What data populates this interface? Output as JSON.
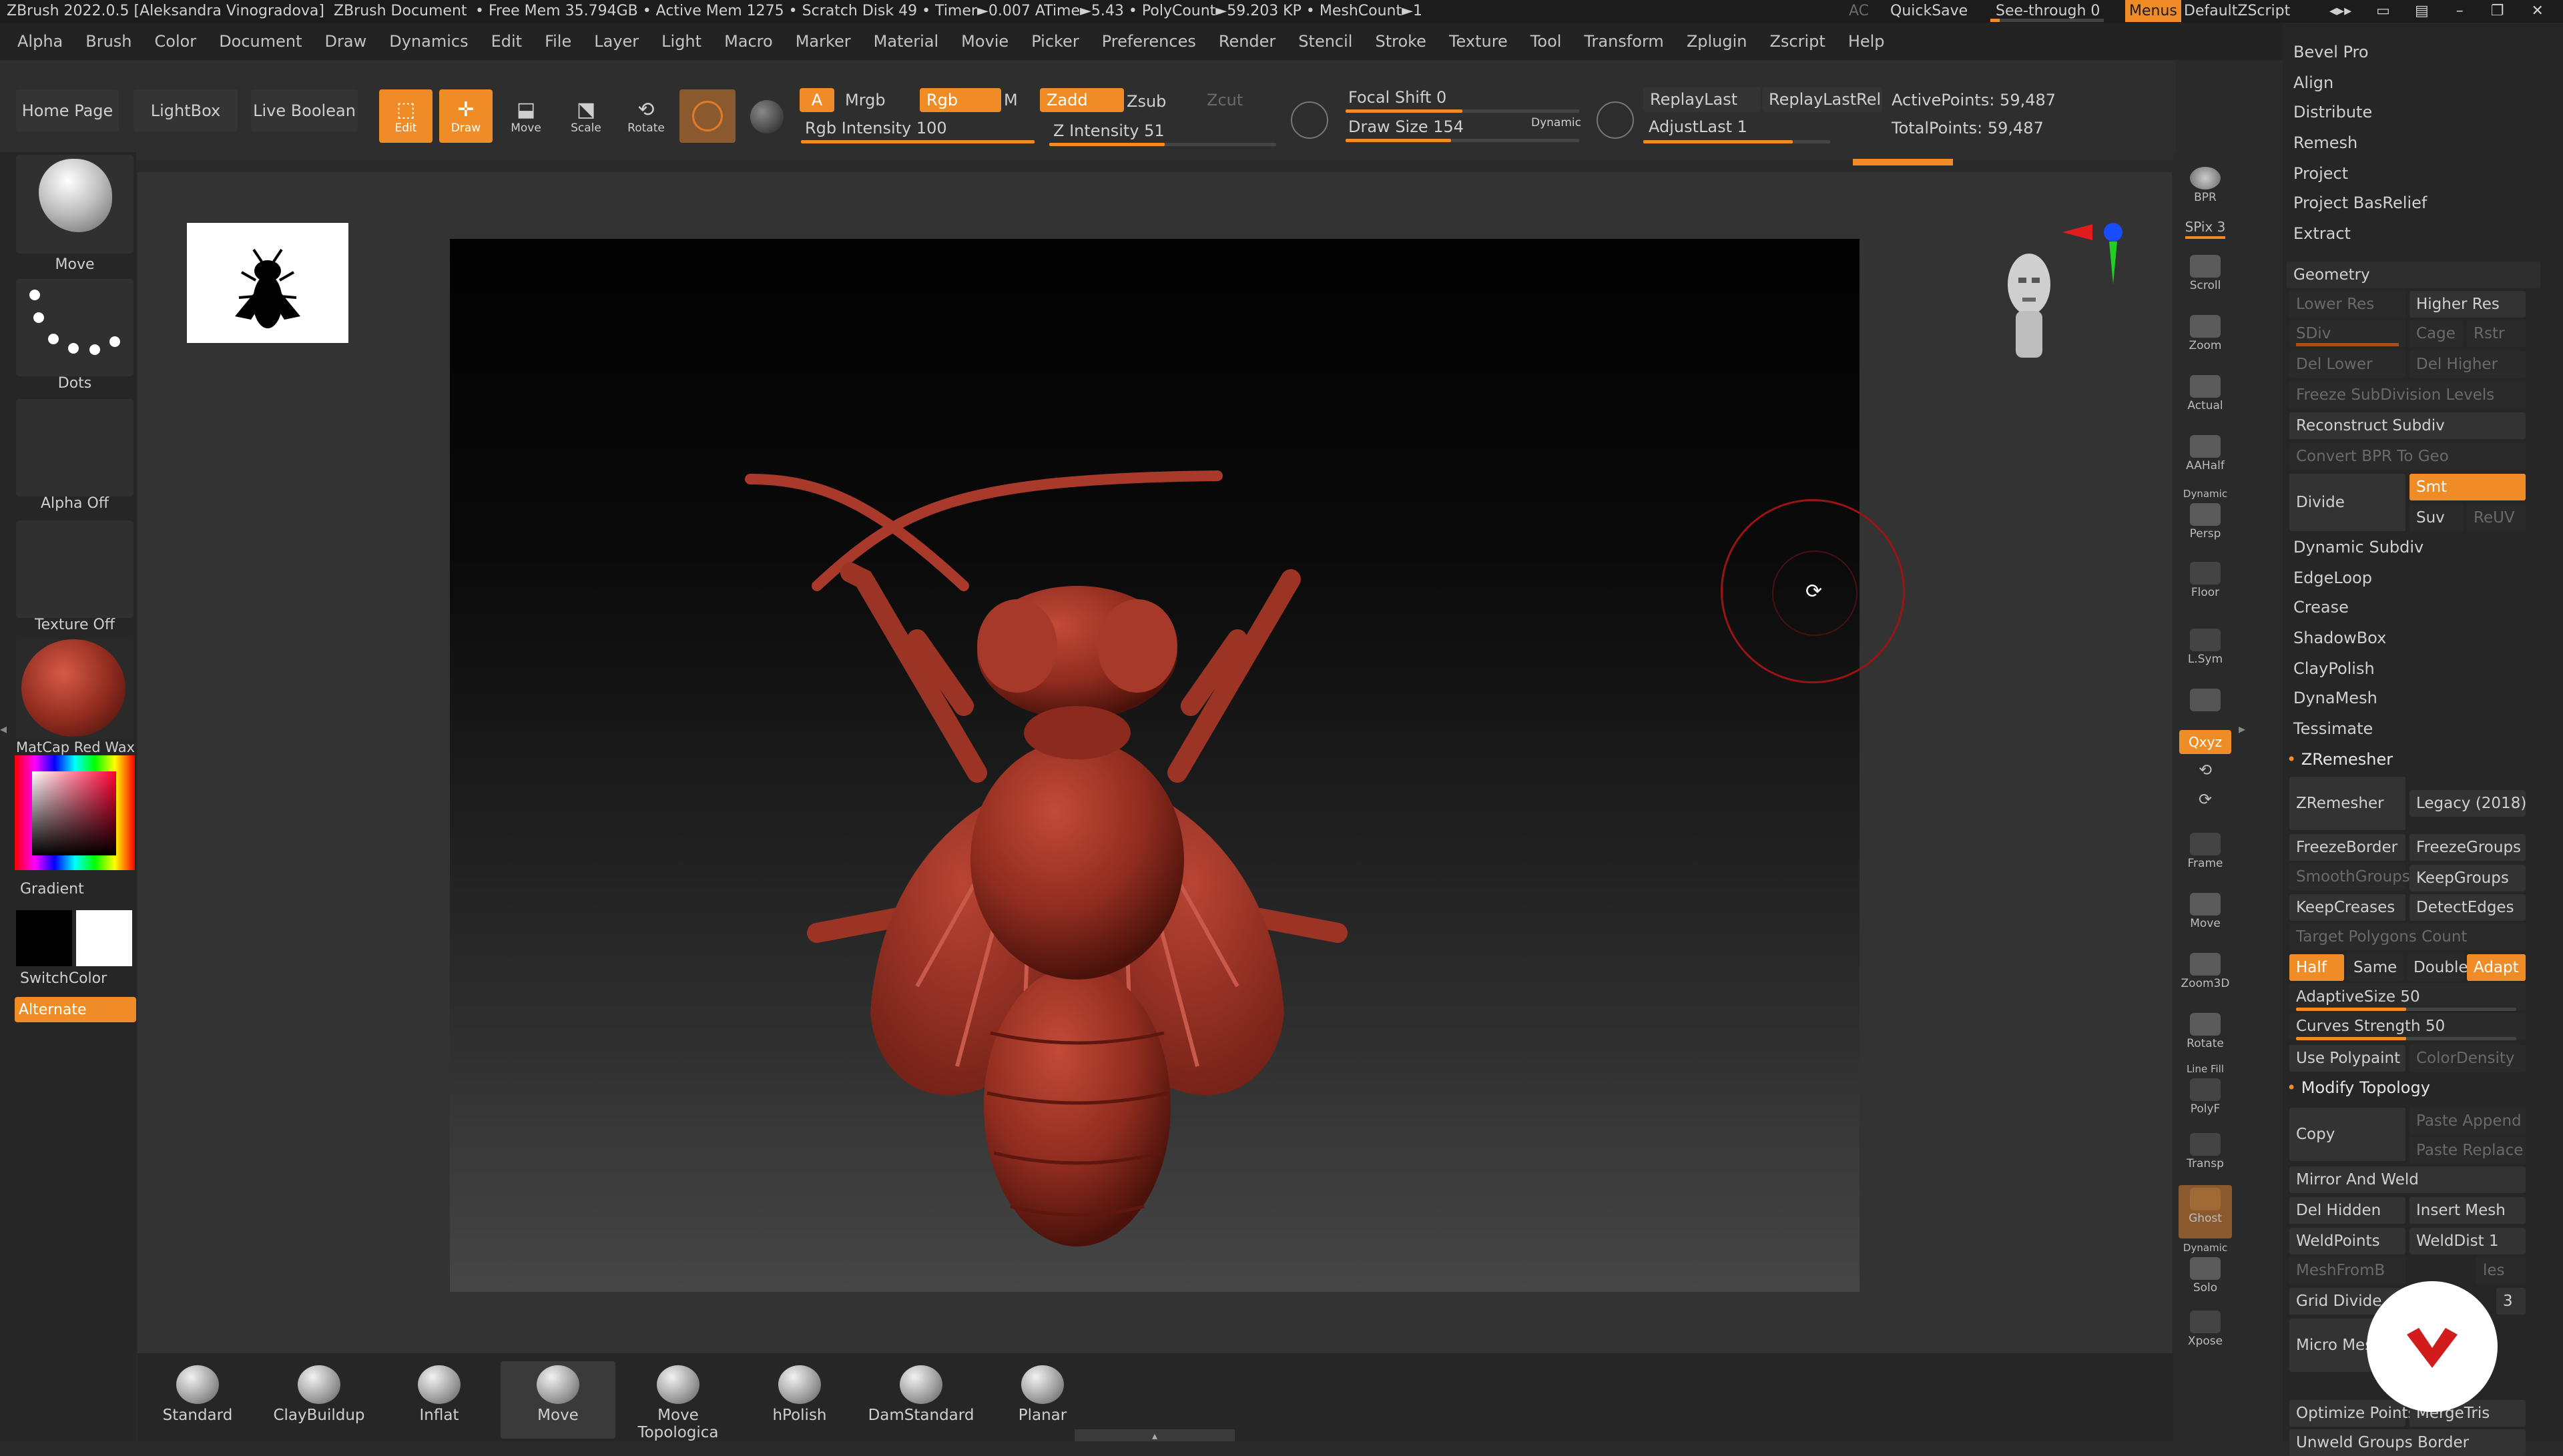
{
  "titlebar": {
    "app": "ZBrush 2022.0.5 [Aleksandra Vinogradova]",
    "doc": "ZBrush Document",
    "stats": "• Free Mem 35.794GB • Active Mem 1275 • Scratch Disk 49 • Timer►0.007 ATime►5.43 • PolyCount►59.203 KP • MeshCount►1",
    "ac": "AC",
    "quicksave": "QuickSave",
    "seethrough": "See-through 0",
    "menus": "Menus",
    "script": "DefaultZScript"
  },
  "menu": [
    "Alpha",
    "Brush",
    "Color",
    "Document",
    "Draw",
    "Dynamics",
    "Edit",
    "File",
    "Layer",
    "Light",
    "Macro",
    "Marker",
    "Material",
    "Movie",
    "Picker",
    "Preferences",
    "Render",
    "Stencil",
    "Stroke",
    "Texture",
    "Tool",
    "Transform",
    "Zplugin",
    "Zscript",
    "Help"
  ],
  "topshelf": {
    "home": "Home Page",
    "lightbox": "LightBox",
    "liveboolean": "Live Boolean",
    "edit": "Edit",
    "draw": "Draw",
    "move": "Move",
    "scale": "Scale",
    "rotate": "Rotate",
    "a": "A",
    "mrgb": "Mrgb",
    "rgb": "Rgb",
    "m": "M",
    "zadd": "Zadd",
    "zsub": "Zsub",
    "zcut": "Zcut",
    "rgb_intensity": "Rgb Intensity 100",
    "z_intensity": "Z Intensity 51",
    "focal_shift": "Focal Shift 0",
    "draw_size": "Draw Size 154",
    "dynamic": "Dynamic",
    "replaylast": "ReplayLast",
    "replaylastrel": "ReplayLastRel",
    "adjustlast": "AdjustLast 1",
    "activepoints": "ActivePoints: 59,487",
    "totalpoints": "TotalPoints: 59,487",
    "rgb_intensity_value": 1.0,
    "z_intensity_value": 0.51,
    "focal_shift_value": 0.5,
    "draw_size_value": 0.45,
    "adjustlast_value": 0.8
  },
  "left": {
    "move": "Move",
    "dots": "Dots",
    "alpha": "Alpha Off",
    "texture": "Texture Off",
    "matcap": "MatCap Red Wax",
    "gradient": "Gradient",
    "switchcolor": "SwitchColor",
    "alternate": "Alternate"
  },
  "righttool": [
    "BPR",
    "SPix 3",
    "Scroll",
    "Zoom",
    "Actual",
    "AAHalf",
    "Persp",
    "Floor",
    "L.Sym",
    "",
    "Qxyz",
    "",
    "",
    "Frame",
    "Move",
    "Zoom3D",
    "Rotate",
    "PolyF",
    "Transp",
    "Ghost",
    "Solo",
    "Xpose"
  ],
  "righttool_dynamic": "Dynamic",
  "righttool_linefill": "Line Fill",
  "panel": {
    "top": [
      "Bevel Pro",
      "Align",
      "Distribute",
      "Remesh",
      "Project",
      "Project BasRelief",
      "Extract"
    ],
    "geometry": "Geometry",
    "lower_res": "Lower Res",
    "higher_res": "Higher Res",
    "sdiv": "SDiv",
    "cage": "Cage",
    "rstr": "Rstr",
    "del_lower": "Del Lower",
    "del_higher": "Del Higher",
    "freeze_subdiv": "Freeze SubDivision Levels",
    "reconstruct": "Reconstruct Subdiv",
    "convert_bpr": "Convert BPR To Geo",
    "divide": "Divide",
    "smt": "Smt",
    "suv": "Suv",
    "reuv": "ReUV",
    "items": [
      "Dynamic Subdiv",
      "EdgeLoop",
      "Crease",
      "ShadowBox",
      "ClayPolish",
      "DynaMesh",
      "Tessimate"
    ],
    "zremesher_hdr": "ZRemesher",
    "zremesher": "ZRemesher",
    "legacy": "Legacy (2018)",
    "freezeborder": "FreezeBorder",
    "freezegroups": "FreezeGroups",
    "smoothgroups": "SmoothGroups",
    "keepgroups": "KeepGroups",
    "keepcreases": "KeepCreases",
    "detectedges": "DetectEdges",
    "target_poly": "Target Polygons Count",
    "half": "Half",
    "same": "Same",
    "double": "Double",
    "adapt": "Adapt",
    "adaptivesize": "AdaptiveSize 50",
    "curves": "Curves Strength 50",
    "usepolypaint": "Use Polypaint",
    "colordensity": "ColorDensity",
    "modify_hdr": "Modify Topology",
    "copy": "Copy",
    "paste_append": "Paste Append",
    "paste_replace": "Paste Replace",
    "mirror_weld": "Mirror And Weld",
    "del_hidden": "Del Hidden",
    "insert_mesh": "Insert Mesh",
    "weldpoints": "WeldPoints",
    "welddist": "WeldDist 1",
    "meshfromb": "MeshFromB",
    "les": "les",
    "grid_divide": "Grid Divide",
    "grid_3": "3",
    "micro_mesh": "Micro Mes",
    "optimize": "Optimize Points",
    "mergetris": "MergeTris",
    "unweld": "Unweld Groups Border",
    "adaptivesize_value": 0.5,
    "curves_value": 0.5
  },
  "brushes": [
    "Standard",
    "ClayBuildup",
    "Inflat",
    "Move",
    "Move Topologica",
    "hPolish",
    "DamStandard",
    "Planar"
  ],
  "colors": {
    "accent": "#f08c26",
    "model": "#a53a2c"
  }
}
